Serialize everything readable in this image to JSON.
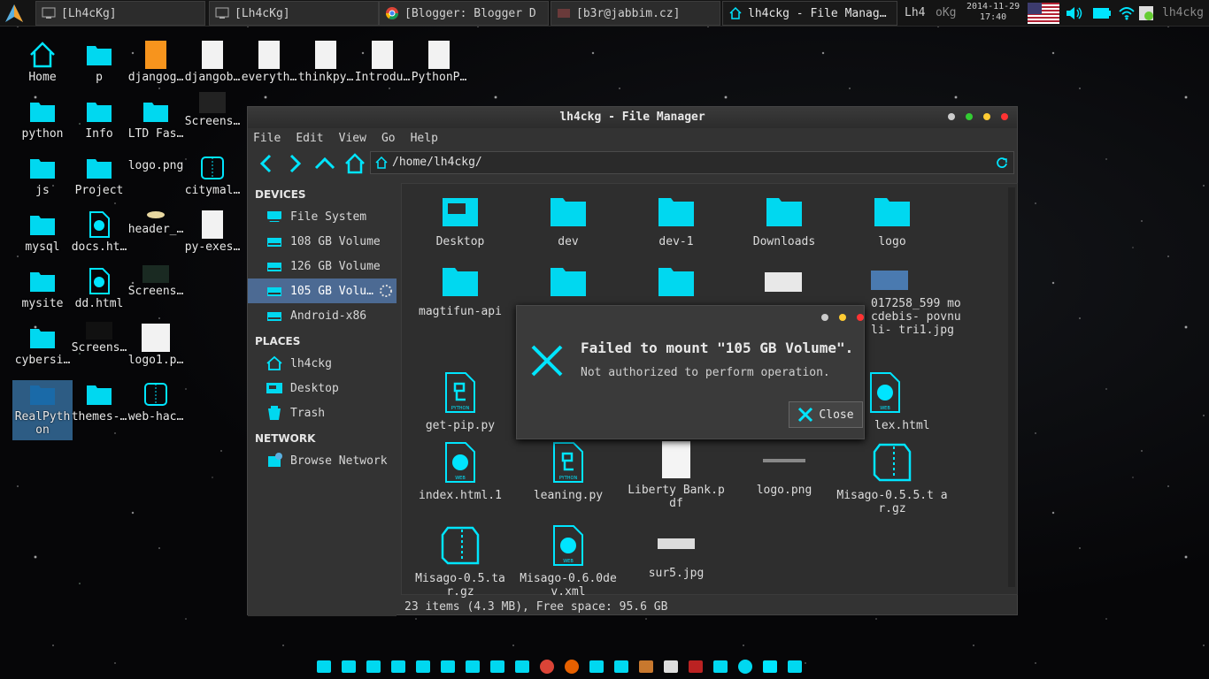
{
  "colors": {
    "accent": "#00e5ff",
    "selection": "#4c6a93",
    "window": "#333333"
  },
  "taskbar": {
    "tasks": [
      {
        "label": "[Lh4cKg]",
        "icon": "terminal-icon"
      },
      {
        "label": "[Lh4cKg]",
        "icon": "terminal-icon"
      },
      {
        "label": "[Blogger: Blogger D",
        "icon": "chrome-icon"
      },
      {
        "label": "[b3r@jabbim.cz]",
        "icon": "chat-icon"
      },
      {
        "label": "lh4ckg - File Manag…",
        "icon": "home-icon"
      }
    ],
    "workspace": "Lh4",
    "user": "oKg",
    "date": "2014-11-29",
    "time": "17:40",
    "username": "lh4ckg"
  },
  "desktop": {
    "icons": [
      "Home",
      "p",
      "djangog…",
      "djangob…",
      "everyth…",
      "thinkpy…",
      "Introdu…",
      "PythonP…",
      "python",
      "Info",
      "LTD Fas…",
      "Screens…",
      "js",
      "Project",
      "logo.png",
      "citymal…",
      "mysql",
      "docs.ht…",
      "header_…",
      "py-exes…",
      "mysite",
      "dd.html",
      "Screens…",
      "cybersi…",
      "Screens…",
      "logo1.p…",
      "RealPyth on",
      "themes-…",
      "web-hac…"
    ]
  },
  "window": {
    "title": "lh4ckg - File Manager",
    "menu": [
      "File",
      "Edit",
      "View",
      "Go",
      "Help"
    ],
    "path": "/home/lh4ckg/",
    "sidebar": {
      "devices_header": "DEVICES",
      "devices": [
        "File System",
        "108 GB Volume",
        "126 GB Volume",
        "105 GB Volu…",
        "Android-x86"
      ],
      "places_header": "PLACES",
      "places": [
        "lh4ckg",
        "Desktop",
        "Trash"
      ],
      "network_header": "NETWORK",
      "network": [
        "Browse Network"
      ]
    },
    "files": [
      "Desktop",
      "dev",
      "dev-1",
      "Downloads",
      "logo",
      "magtifun-api",
      "017258_599 mocdebis- povnuli- tri1.jpg",
      "get-pip.py",
      "lex.html",
      "index.html.1",
      "leaning.py",
      "Liberty Bank.pdf",
      "logo.png",
      "Misago-0.5.5.t ar.gz",
      "Misago-0.5.ta r.gz",
      "Misago-0.6.0de v.xml",
      "sur5.jpg"
    ],
    "status": "23 items (4.3 MB), Free space: 95.6 GB"
  },
  "dialog": {
    "title": "Failed to mount \"105 GB Volume\".",
    "message": "Not authorized to perform operation.",
    "close_label": "Close"
  },
  "dock": [
    "screenshot-icon",
    "photo-icon",
    "terminal-icon",
    "window-icon",
    "camera-icon",
    "folder-icon",
    "folder-icon",
    "search-doc-icon",
    "trash-icon",
    "chrome-icon",
    "firefox-icon",
    "settings-icon",
    "tools-icon",
    "sublime-icon",
    "zim-icon",
    "filezilla-icon",
    "contacts-icon",
    "skype-icon",
    "usb-icon",
    "windows-icon"
  ]
}
